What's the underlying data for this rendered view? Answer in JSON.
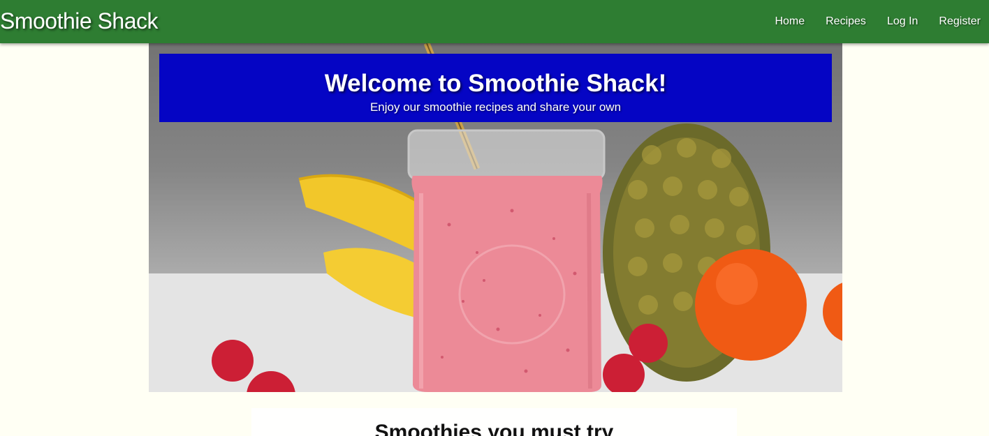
{
  "header": {
    "brand": "Smoothie Shack",
    "nav": [
      "Home",
      "Recipes",
      "Log In",
      "Register"
    ]
  },
  "hero": {
    "title": "Welcome to Smoothie Shack!",
    "subtitle": "Enjoy our smoothie recipes and share your own"
  },
  "section": {
    "title": "Smoothies you must try"
  },
  "colors": {
    "navbar": "#2e7d32",
    "hero_box": "#0505c4",
    "page_background": "#fffff4"
  },
  "icons": [
    "smoothie-photo"
  ]
}
